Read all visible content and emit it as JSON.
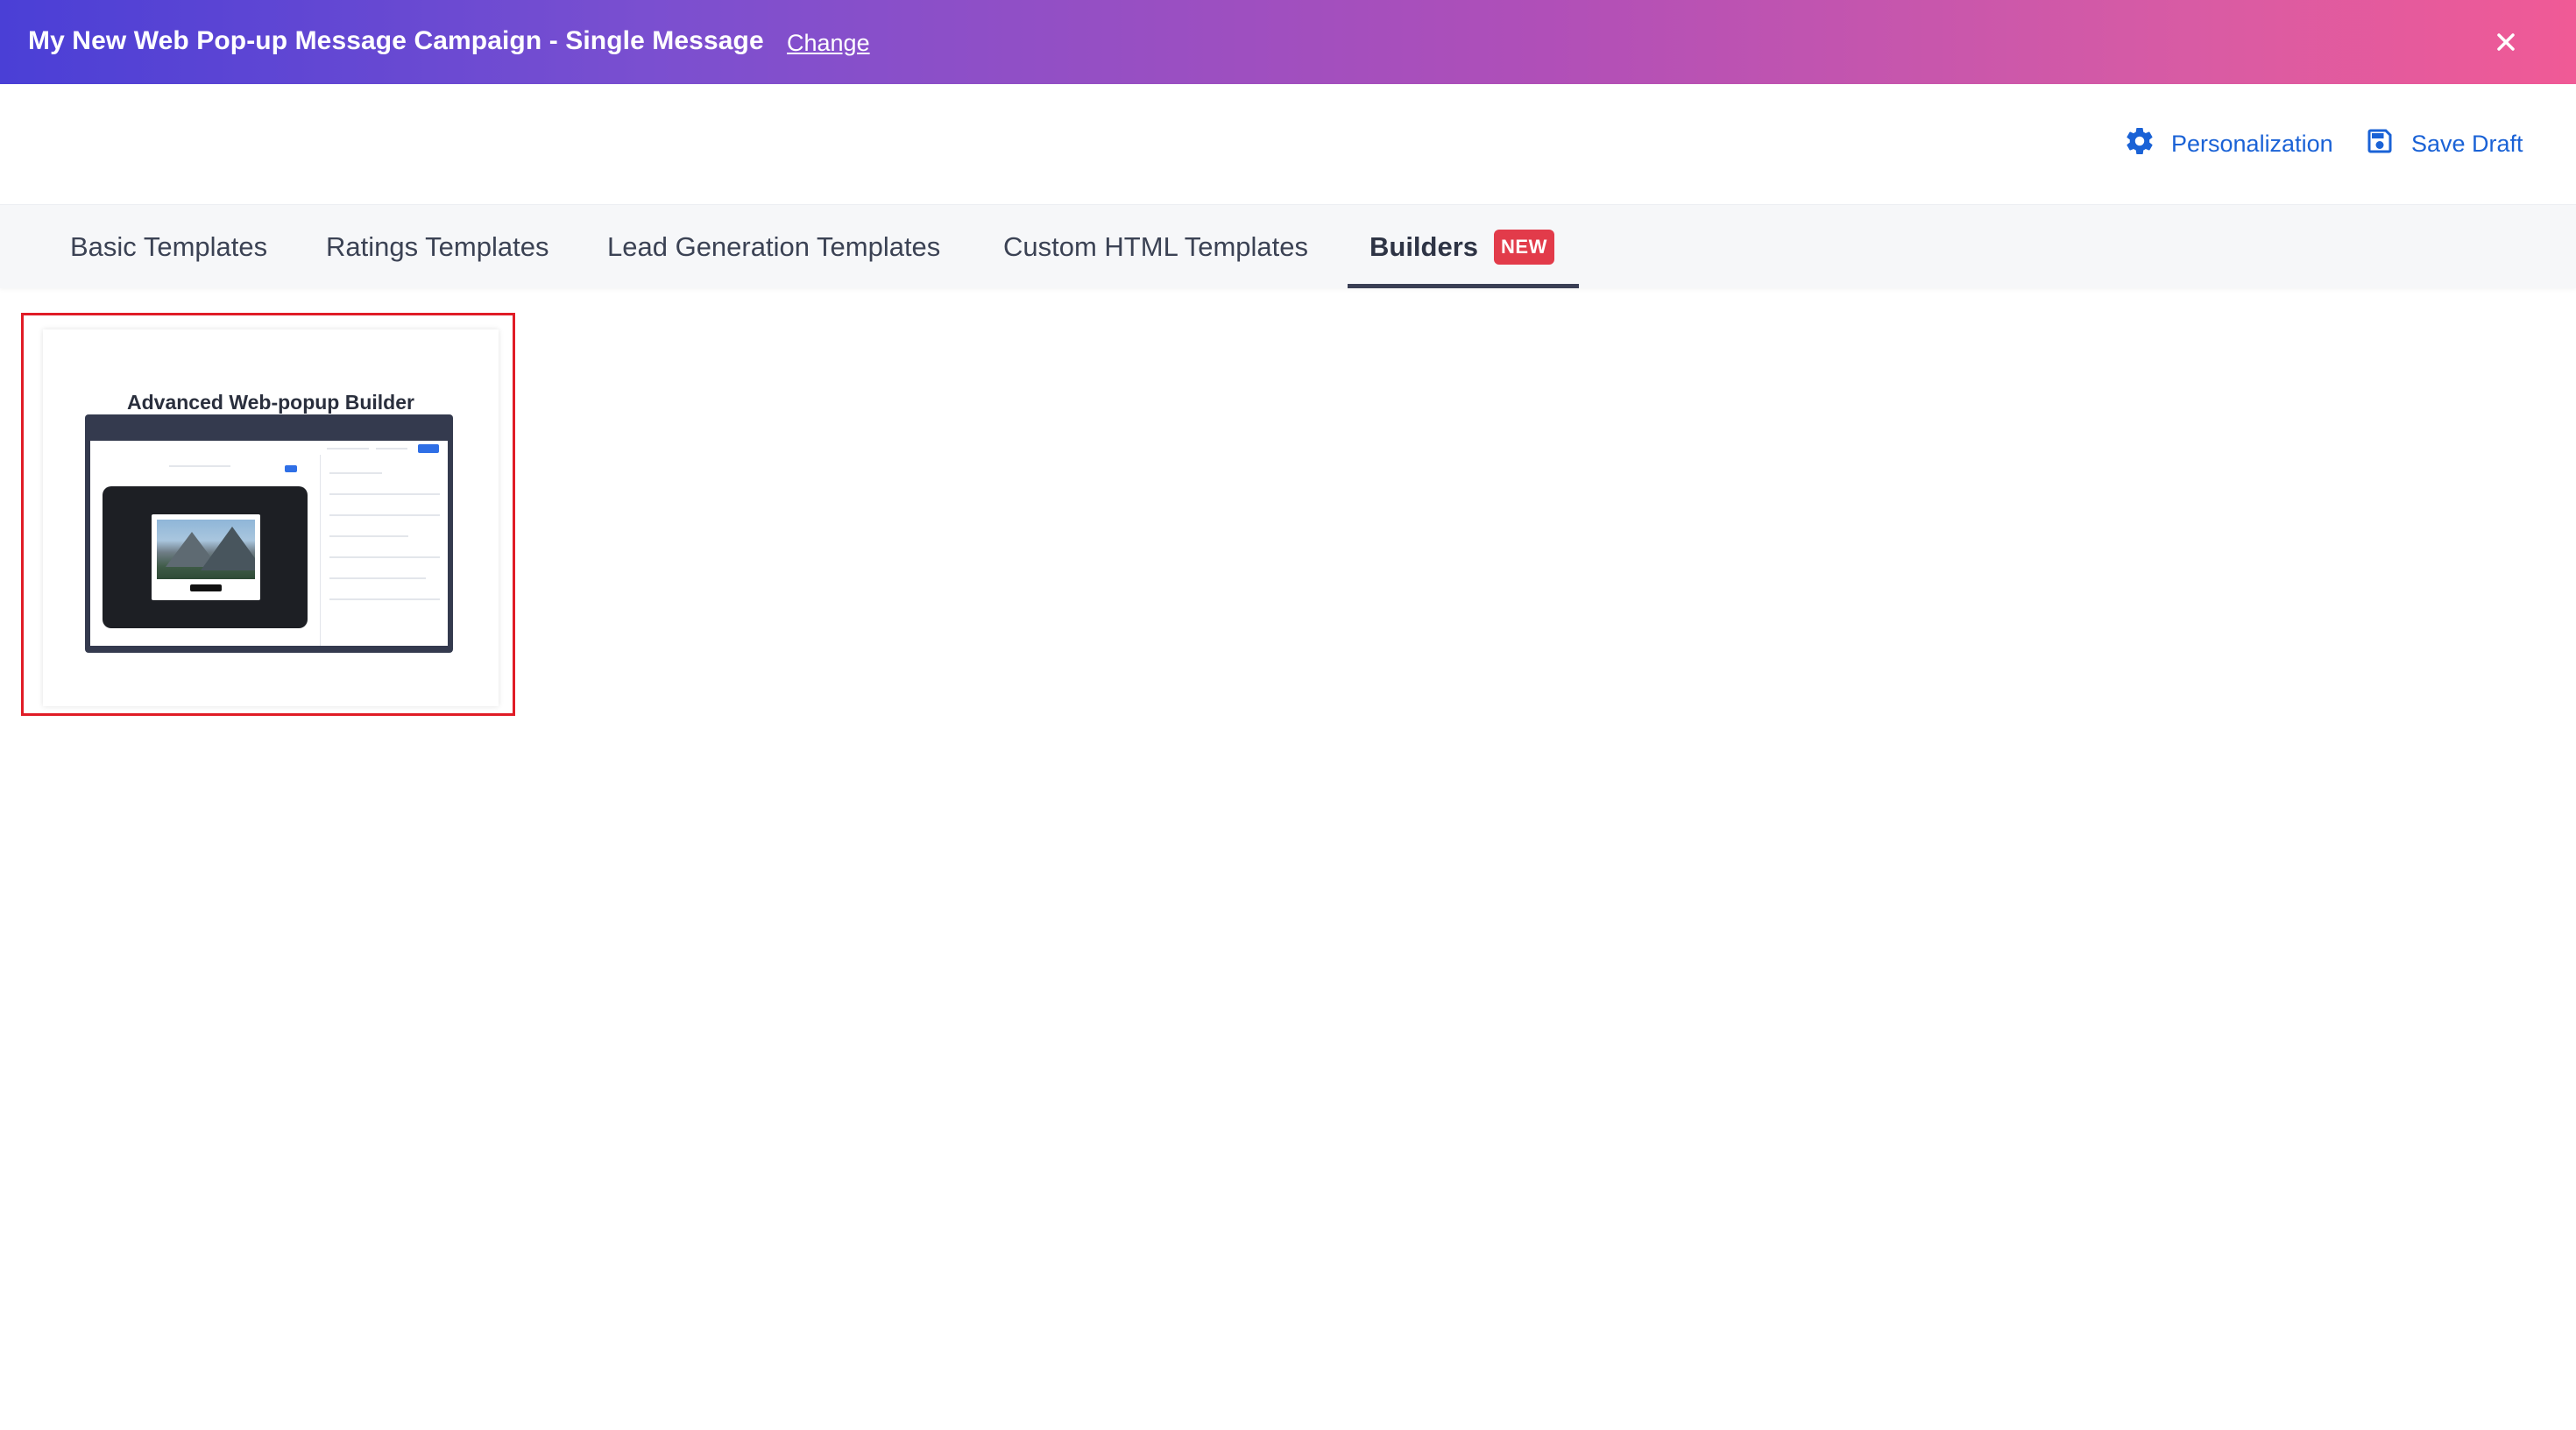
{
  "header": {
    "title": "My New Web Pop-up Message Campaign - Single Message",
    "change_label": "Change",
    "close_icon": "close-icon"
  },
  "actions": {
    "personalization_label": "Personalization",
    "personalization_icon": "gear-icon",
    "save_draft_label": "Save Draft",
    "save_draft_icon": "floppy-disk-icon",
    "color": "#1a62d6"
  },
  "tabs": [
    {
      "label": "Basic Templates"
    },
    {
      "label": "Ratings Templates"
    },
    {
      "label": "Lead Generation Templates"
    },
    {
      "label": "Custom HTML Templates"
    },
    {
      "label": "Builders",
      "active": true,
      "badge": "NEW"
    }
  ],
  "templates": [
    {
      "title": "Advanced Web-popup Builder",
      "selected": true
    }
  ],
  "colors": {
    "gradient_start": "#4a3fd6",
    "gradient_end": "#f05a96",
    "badge": "#e23b4a",
    "selection_border": "#e01c26"
  }
}
